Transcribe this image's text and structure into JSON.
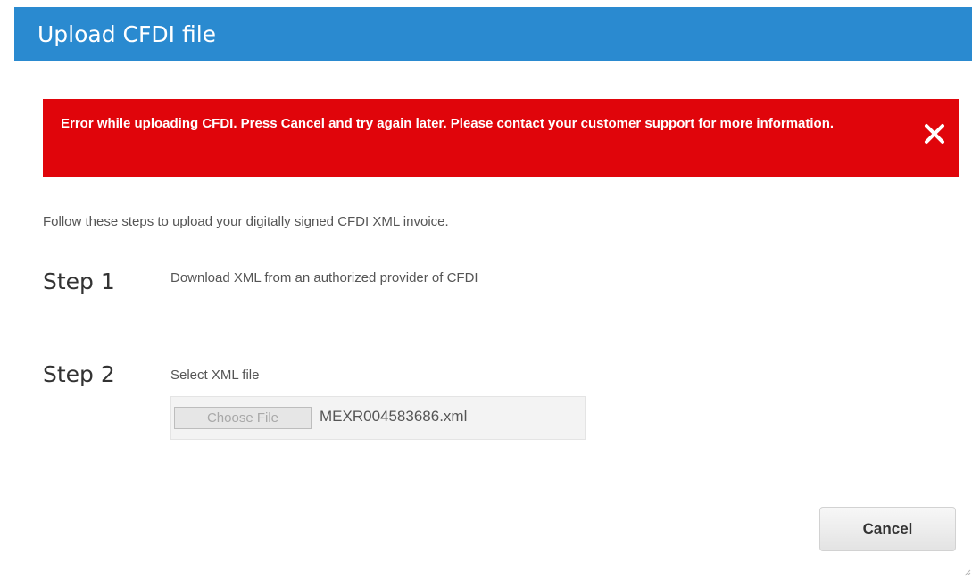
{
  "dialog": {
    "title": "Upload CFDI file"
  },
  "error": {
    "message": "Error while uploading CFDI. Press Cancel and try again later. Please contact your customer support for more information.",
    "close_icon": "close-icon",
    "color": "#e0050b"
  },
  "intro": "Follow these steps to upload your digitally signed CFDI XML invoice.",
  "steps": [
    {
      "label": "Step 1",
      "description": "Download XML from an authorized provider of CFDI"
    },
    {
      "label": "Step 2",
      "description": "Select XML file",
      "choose_file_label": "Choose File",
      "file_name": "MEXR004583686.xml"
    }
  ],
  "actions": {
    "cancel_label": "Cancel"
  },
  "colors": {
    "header": "#2a8ad0",
    "error": "#e0050b"
  }
}
